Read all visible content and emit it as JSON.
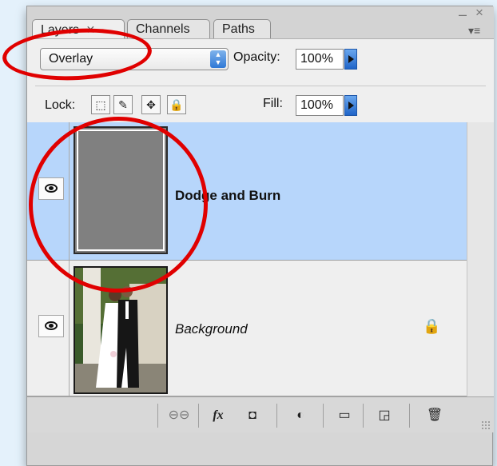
{
  "tabs": [
    {
      "label": "Layers",
      "close": "✕",
      "active": true
    },
    {
      "label": "Channels",
      "active": false
    },
    {
      "label": "Paths",
      "active": false
    }
  ],
  "window": {
    "minimize": "–",
    "close": "×",
    "menu": "▾≡"
  },
  "blend_mode": {
    "value": "Overlay"
  },
  "opacity": {
    "label": "Opacity:",
    "value": "100%"
  },
  "lock": {
    "label": "Lock:"
  },
  "fill": {
    "label": "Fill:",
    "value": "100%"
  },
  "layers": [
    {
      "name": "Dodge and Burn",
      "visible": true,
      "selected": true,
      "thumbnail_color": "#808080"
    },
    {
      "name": "Background",
      "visible": true,
      "selected": false,
      "locked": true
    }
  ],
  "toolbar": {
    "link": "⊖⊖",
    "fx": "fx",
    "mask": "◘",
    "adjustment": "◐",
    "folder": "▭",
    "new_layer": "◲",
    "trash": "🗑"
  },
  "colors": {
    "selected_row": "#b7d6fb",
    "annotation": "#e00000",
    "accent": "#2f78d6"
  }
}
